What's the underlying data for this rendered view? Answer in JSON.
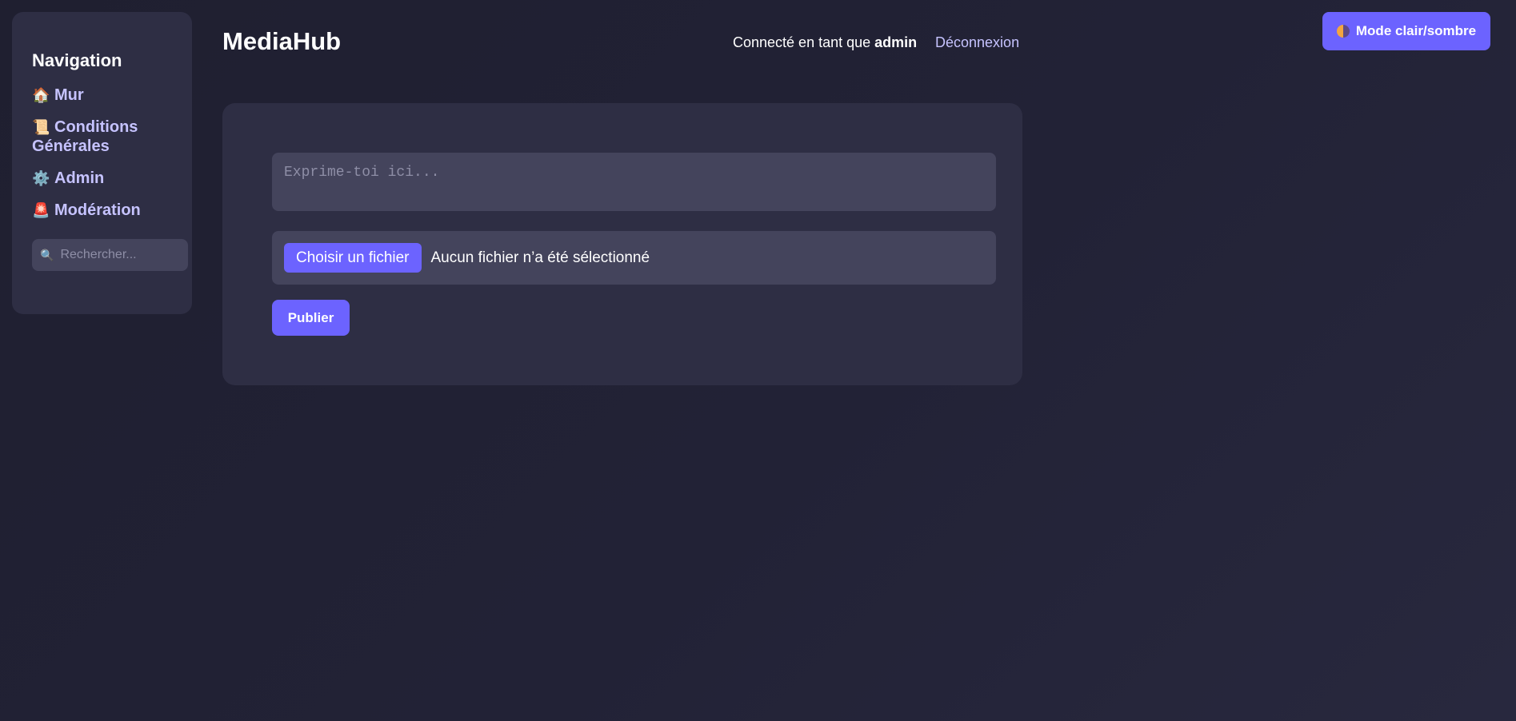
{
  "sidebar": {
    "title": "Navigation",
    "items": [
      {
        "icon": "house-icon",
        "emoji": "🏠",
        "label": "Mur"
      },
      {
        "icon": "scroll-icon",
        "emoji": "📜",
        "label": "Conditions Générales"
      },
      {
        "icon": "gear-icon",
        "emoji": "⚙️",
        "label": "Admin"
      },
      {
        "icon": "siren-icon",
        "emoji": "🚨",
        "label": "Modération"
      }
    ],
    "search": {
      "icon": "search-icon",
      "glyph": "🔍",
      "placeholder": "Rechercher..."
    }
  },
  "header": {
    "brand": "MediaHub",
    "user_prefix": "Connecté en tant que",
    "username": "admin",
    "logout_label": "Déconnexion"
  },
  "theme_toggle": {
    "icon": "half-moon-icon",
    "label": "Mode clair/sombre"
  },
  "post_form": {
    "textarea_placeholder": "Exprime-toi ici...",
    "file_button_label": "Choisir un fichier",
    "file_status": "Aucun fichier n’a été sélectionné",
    "publish_label": "Publier"
  },
  "colors": {
    "accent": "#6c63ff",
    "link": "#c6c3ff",
    "card": "#2e2e44",
    "input": "#44445c"
  }
}
